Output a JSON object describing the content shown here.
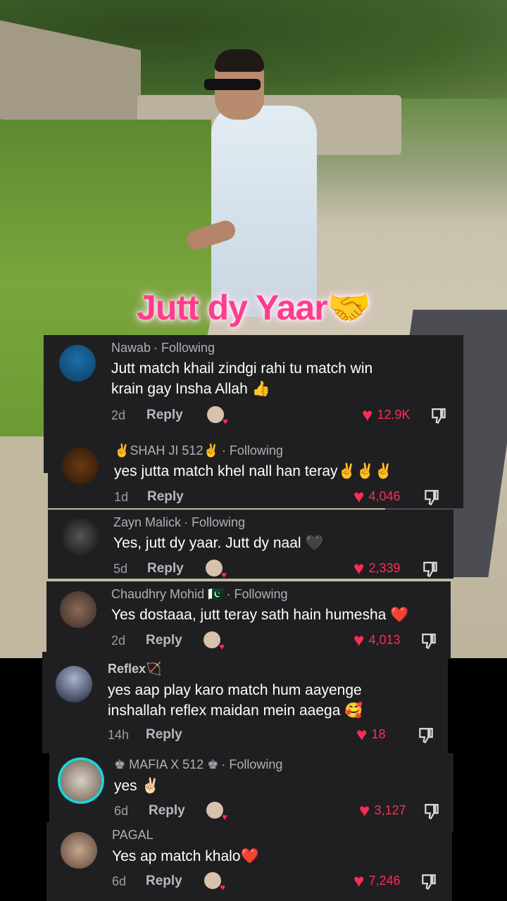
{
  "video": {
    "caption": "Jutt dy Yaar🤝"
  },
  "comments": [
    {
      "username": "Nawab",
      "following": "· Following",
      "text_line1": "Jutt match khail zindgi rahi tu match win",
      "text_line2": "krain gay Insha Allah 👍",
      "time": "2d",
      "reply": "Reply",
      "likes": "12.9K"
    },
    {
      "username": "✌️SHAH JI 512✌️",
      "following": "· Following",
      "text_line1": "yes jutta match khel nall han teray✌️✌️✌️",
      "text_line2": "",
      "time": "1d",
      "reply": "Reply",
      "likes": "4,046"
    },
    {
      "username": "Zayn Malick",
      "following": "· Following",
      "text_line1": "Yes, jutt dy yaar. Jutt dy naal 🖤",
      "text_line2": "",
      "time": "5d",
      "reply": "Reply",
      "likes": "2,339"
    },
    {
      "username": "Chaudhry Mohid 🇵🇰",
      "following": "· Following",
      "text_line1": "Yes dostaaa, jutt teray sath hain humesha ❤️",
      "text_line2": "",
      "time": "2d",
      "reply": "Reply",
      "likes": "4,013"
    },
    {
      "username": "Reflex🏹",
      "following": "",
      "text_line1": "yes aap play karo match hum aayenge",
      "text_line2": "inshallah reflex maidan mein aaega 🥰",
      "time": "14h",
      "reply": "Reply",
      "likes": "18"
    },
    {
      "username": "♚ MAFIA X 512 ♚",
      "following": "· Following",
      "text_line1": "yes ✌🏻",
      "text_line2": "",
      "time": "6d",
      "reply": "Reply",
      "likes": "3,127"
    },
    {
      "username": "PAGAL",
      "following": "",
      "text_line1": "Yes ap match khalo❤️",
      "text_line2": "",
      "time": "6d",
      "reply": "Reply",
      "likes": "7,246"
    }
  ],
  "colors": {
    "panel": "#1f1f21",
    "heart": "#fe2c55",
    "caption": "#ff3d8e"
  }
}
